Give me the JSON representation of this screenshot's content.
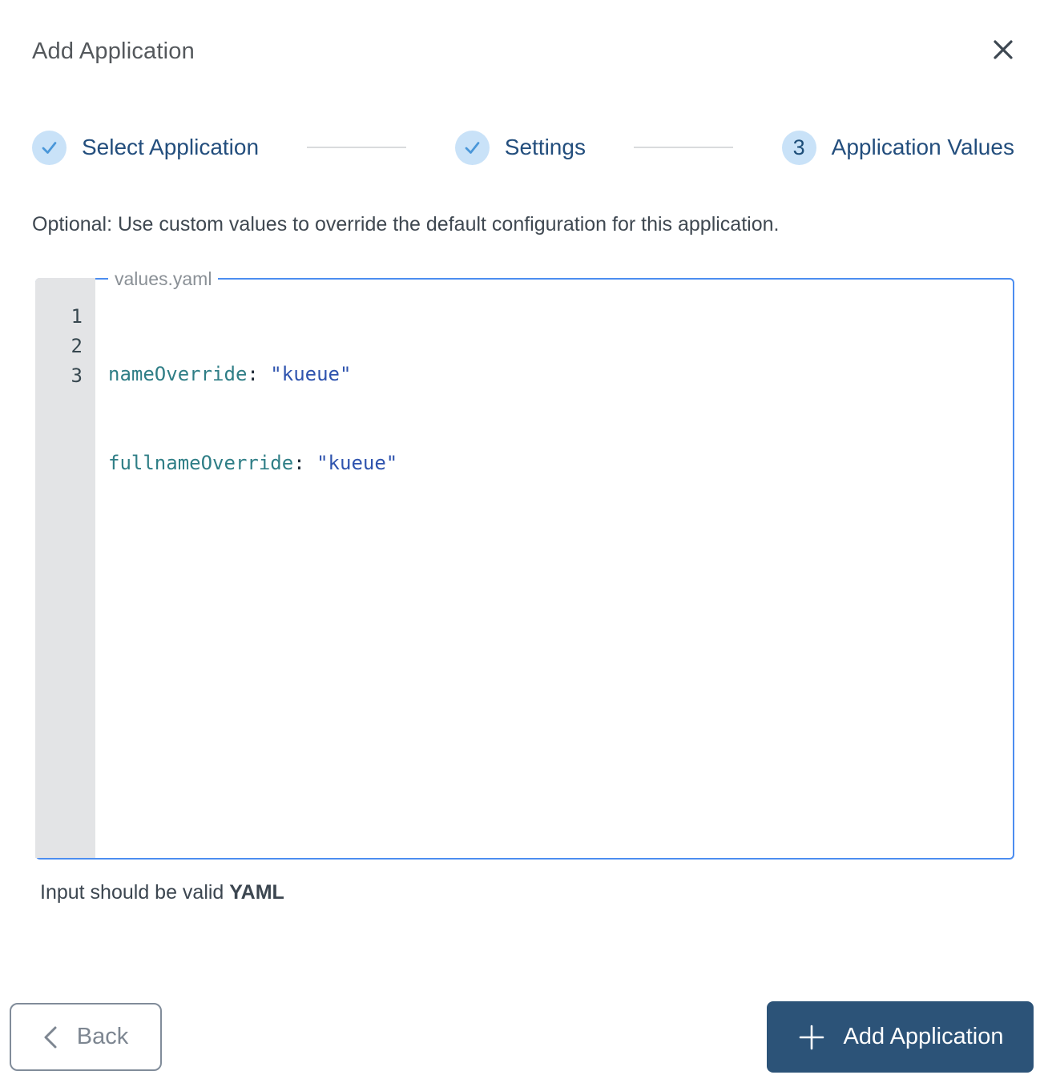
{
  "header": {
    "title": "Add Application"
  },
  "stepper": {
    "steps": [
      {
        "label": "Select Application",
        "state": "completed",
        "icon": "check-icon"
      },
      {
        "label": "Settings",
        "state": "completed",
        "icon": "check-icon"
      },
      {
        "label": "Application Values",
        "state": "active",
        "number": "3"
      }
    ]
  },
  "description": "Optional: Use custom values to override the default configuration for this application.",
  "editor": {
    "filename_label": "values.yaml",
    "line_numbers": [
      "1",
      "2",
      "3"
    ],
    "lines": [
      {
        "key": "nameOverride",
        "colon": ":",
        "value": "\"kueue\""
      },
      {
        "key": "fullnameOverride",
        "colon": ":",
        "value": "\"kueue\""
      }
    ]
  },
  "hint": {
    "text": "Input should be valid ",
    "emphasis": "YAML"
  },
  "footer": {
    "back_button": {
      "label": "Back",
      "icon": "chevron-left-icon"
    },
    "add_button": {
      "label": "Add Application",
      "icon": "plus-icon"
    }
  },
  "colors": {
    "accent_border_blue": "#4c8df0",
    "navy_text": "#234e7d",
    "button_navy": "#2c5378",
    "step_circle_bg": "#c9e2f8",
    "check_blue": "#4a97d9",
    "connector_gray": "#d9dbdd",
    "gutter_bg": "#e3e4e6",
    "yaml_key": "#2f7e86",
    "yaml_string": "#2e53ae"
  }
}
